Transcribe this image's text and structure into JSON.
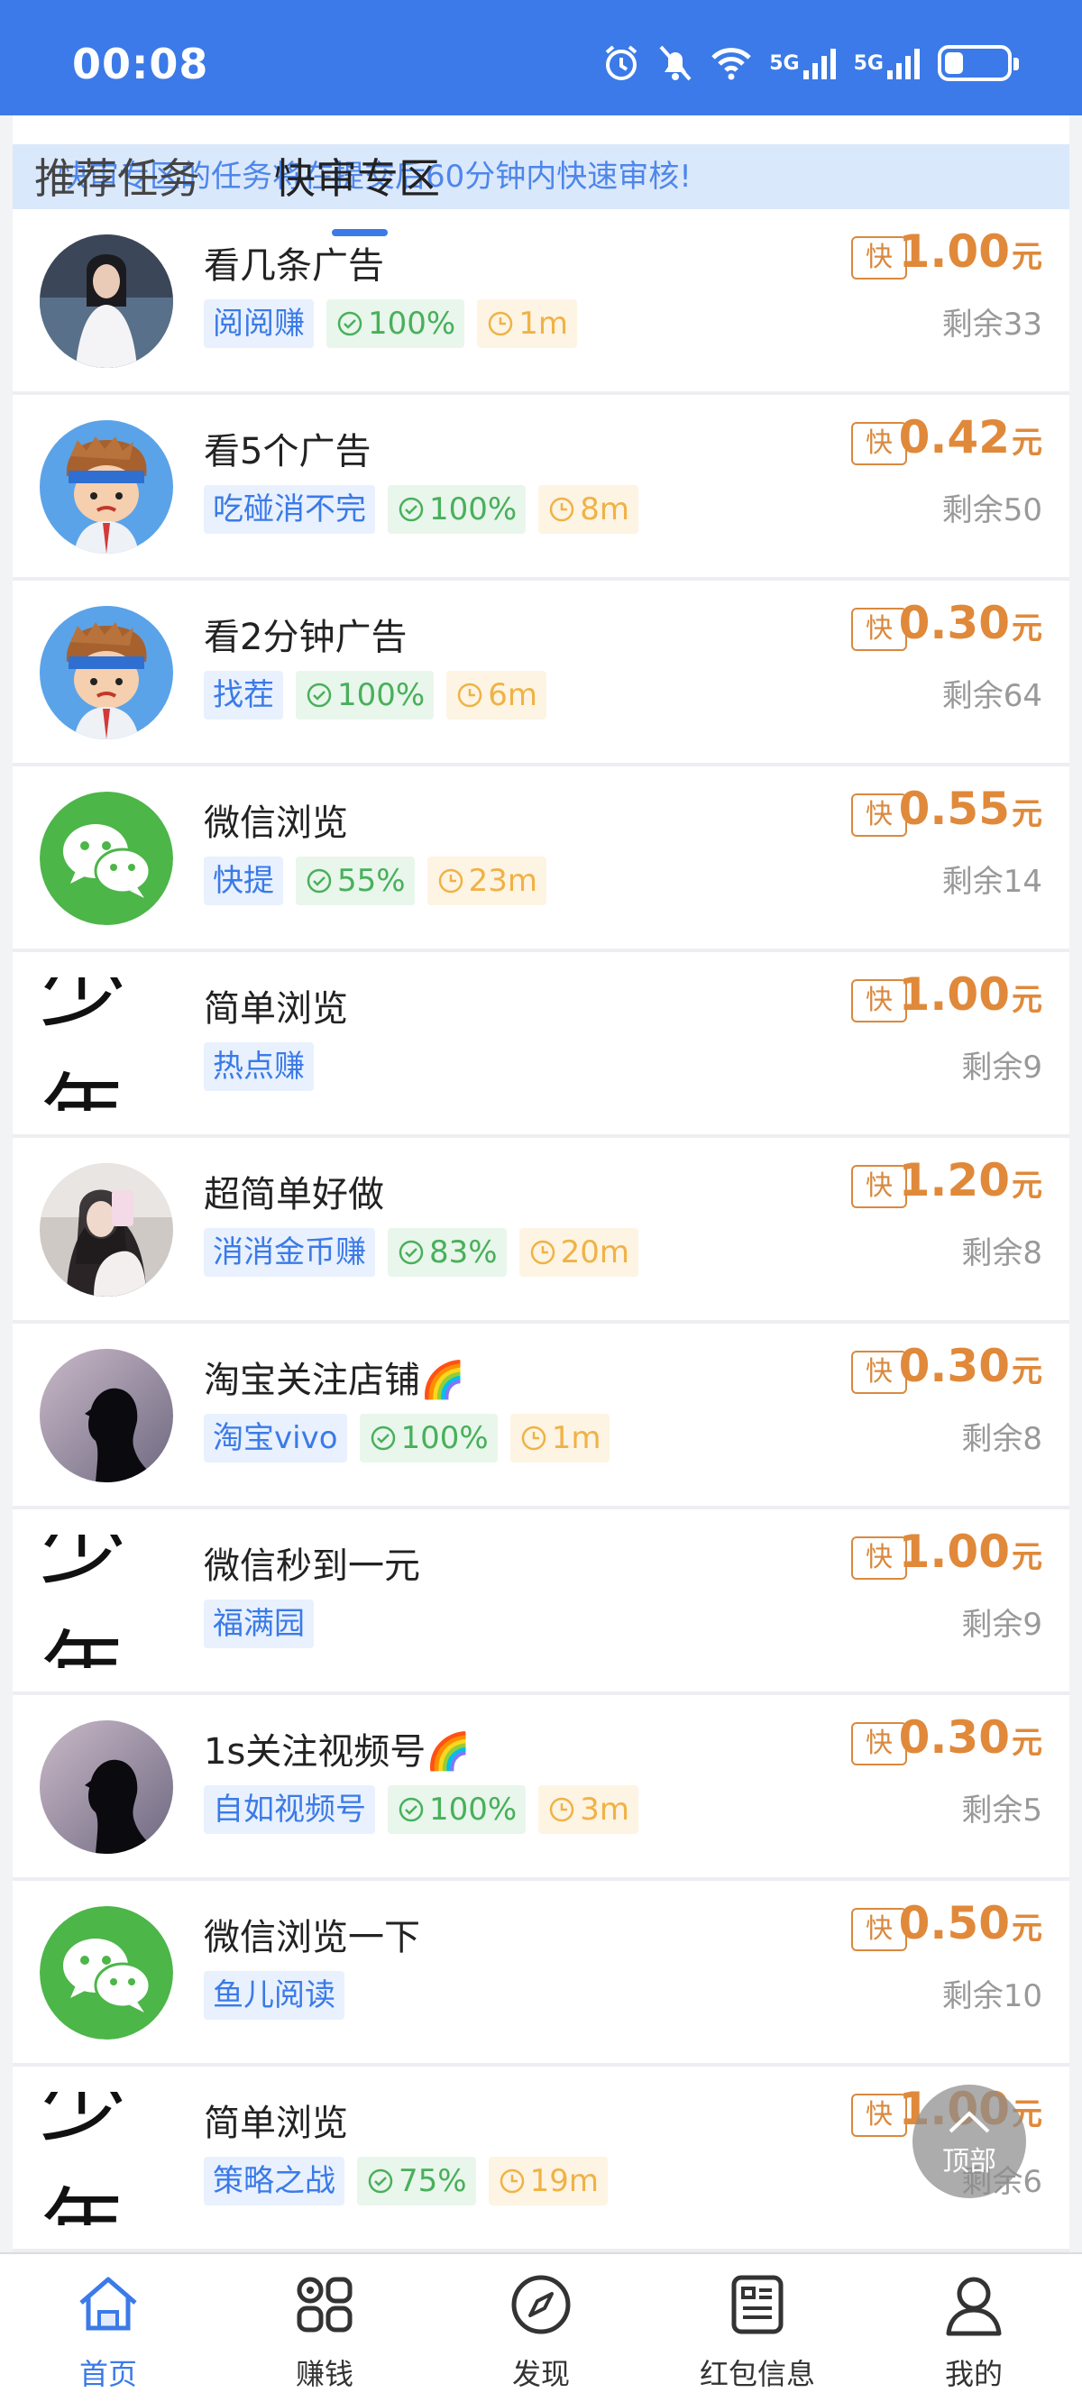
{
  "status_bar": {
    "time": "00:08",
    "net1": "5G",
    "net2": "5G",
    "battery_level": 0.3
  },
  "tabs": [
    {
      "label": "推荐任务",
      "active": false
    },
    {
      "label": "快审专区",
      "active": true
    }
  ],
  "notice": "快审专区的任务将在提交后60分钟内快速审核!",
  "fast_badge": "快",
  "unit": "元",
  "tasks": [
    {
      "title": "看几条广告",
      "app": "阅阅赚",
      "rate": "100%",
      "time": "1m",
      "price": "1.00",
      "remain": "剩余33",
      "avatar": "photo-girl-white"
    },
    {
      "title": "看5个广告",
      "app": "吃碰消不完",
      "rate": "100%",
      "time": "8m",
      "price": "0.42",
      "remain": "剩余50",
      "avatar": "cartoon-boy"
    },
    {
      "title": "看2分钟广告",
      "app": "找茬",
      "rate": "100%",
      "time": "6m",
      "price": "0.30",
      "remain": "剩余64",
      "avatar": "cartoon-boy"
    },
    {
      "title": "微信浏览",
      "app": "快提",
      "rate": "55%",
      "time": "23m",
      "price": "0.55",
      "remain": "剩余14",
      "avatar": "wechat"
    },
    {
      "title": "简单浏览",
      "app": "热点赚",
      "rate": "",
      "time": "",
      "price": "1.00",
      "remain": "剩余9",
      "avatar": "text-logo",
      "logo_text": "少年"
    },
    {
      "title": "超简单好做",
      "app": "消消金币赚",
      "rate": "83%",
      "time": "20m",
      "price": "1.20",
      "remain": "剩余8",
      "avatar": "photo-girl-phone"
    },
    {
      "title": "淘宝关注店铺🌈",
      "app": "淘宝vivo",
      "rate": "100%",
      "time": "1m",
      "price": "0.30",
      "remain": "剩余8",
      "avatar": "silhouette"
    },
    {
      "title": "微信秒到一元",
      "app": "福满园",
      "rate": "",
      "time": "",
      "price": "1.00",
      "remain": "剩余9",
      "avatar": "text-logo",
      "logo_text": "少年"
    },
    {
      "title": "1s关注视频号🌈",
      "app": "自如视频号",
      "rate": "100%",
      "time": "3m",
      "price": "0.30",
      "remain": "剩余5",
      "avatar": "silhouette"
    },
    {
      "title": "微信浏览一下",
      "app": "鱼儿阅读",
      "rate": "",
      "time": "",
      "price": "0.50",
      "remain": "剩余10",
      "avatar": "wechat"
    },
    {
      "title": "简单浏览",
      "app": "策略之战",
      "rate": "75%",
      "time": "19m",
      "price": "1.00",
      "remain": "剩余6",
      "avatar": "text-logo",
      "logo_text": "少年"
    }
  ],
  "top_button": "顶部",
  "bottom_nav": [
    {
      "label": "首页",
      "icon": "home-icon",
      "active": true
    },
    {
      "label": "赚钱",
      "icon": "apps-grid-icon",
      "active": false
    },
    {
      "label": "发现",
      "icon": "compass-icon",
      "active": false
    },
    {
      "label": "红包信息",
      "icon": "message-board-icon",
      "active": false
    },
    {
      "label": "我的",
      "icon": "user-icon",
      "active": false
    }
  ],
  "colors": {
    "brand_blue": "#3b7ae8",
    "price_orange": "#e0893a",
    "rate_green": "#48b05a",
    "time_yellow": "#f0b246",
    "wechat_green": "#4cb648"
  }
}
